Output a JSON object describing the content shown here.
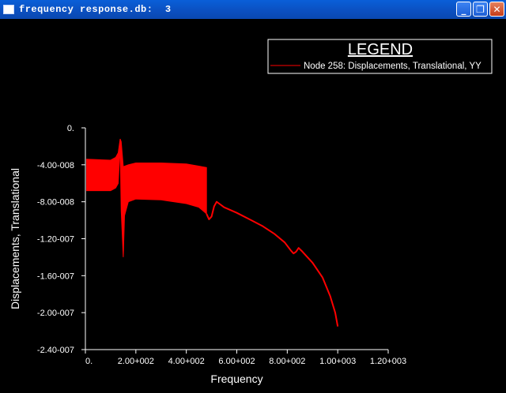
{
  "window": {
    "title": "frequency response.db:  3",
    "buttons": [
      {
        "name": "minimize-button",
        "icon": "minimize-icon",
        "glyph": "_"
      },
      {
        "name": "restore-button",
        "icon": "restore-icon",
        "glyph": "❐"
      },
      {
        "name": "close-button",
        "icon": "close-icon",
        "glyph": "✕"
      }
    ]
  },
  "chart_data": {
    "type": "line",
    "title": "",
    "xlabel": "Frequency",
    "ylabel": "Displacements, Translational",
    "xlim": [
      0,
      1200
    ],
    "ylim": [
      -2.4e-07,
      0
    ],
    "xticks": [
      0,
      200,
      400,
      600,
      800,
      1000,
      1200
    ],
    "xtick_labels": [
      "0.",
      "2.00+002",
      "4.00+002",
      "6.00+002",
      "8.00+002",
      "1.00+003",
      "1.20+003"
    ],
    "yticks": [
      0,
      -4e-08,
      -8e-08,
      -1.2e-07,
      -1.6e-07,
      -2e-07,
      -2.4e-07
    ],
    "ytick_labels": [
      "0.",
      "-4.00-008",
      "-8.00-008",
      "-1.20-007",
      "-1.60-007",
      "-2.00-007",
      "-2.40-007"
    ],
    "grid": false,
    "legend": {
      "title": "LEGEND",
      "placement": "top-right"
    },
    "colors": {
      "background": "#000000",
      "axis": "#ffffff",
      "series": "#ff0000"
    },
    "series": [
      {
        "name": "Node 258: Displacements, Translational, YY",
        "color": "#ff0000",
        "band_upper": [
          [
            5,
            -3.4e-08
          ],
          [
            100,
            -3.5e-08
          ],
          [
            120,
            -3.2e-08
          ],
          [
            130,
            -2.7e-08
          ],
          [
            138,
            -1.2e-08
          ],
          [
            142,
            -1.5e-08
          ],
          [
            150,
            -4.2e-08
          ],
          [
            170,
            -4e-08
          ],
          [
            200,
            -3.8e-08
          ],
          [
            300,
            -3.8e-08
          ],
          [
            400,
            -3.9e-08
          ],
          [
            480,
            -4.3e-08
          ]
        ],
        "band_lower": [
          [
            5,
            -6.8e-08
          ],
          [
            100,
            -6.8e-08
          ],
          [
            120,
            -6.5e-08
          ],
          [
            130,
            -6e-08
          ],
          [
            138,
            -2e-08
          ],
          [
            142,
            -9e-08
          ],
          [
            150,
            -1.4e-07
          ],
          [
            155,
            -9.5e-08
          ],
          [
            170,
            -8e-08
          ],
          [
            200,
            -7.7e-08
          ],
          [
            300,
            -7.8e-08
          ],
          [
            400,
            -8.2e-08
          ],
          [
            450,
            -8.6e-08
          ],
          [
            480,
            -9.3e-08
          ]
        ],
        "tail": [
          [
            480,
            -9.3e-08
          ],
          [
            490,
            -9.9e-08
          ],
          [
            500,
            -9.6e-08
          ],
          [
            510,
            -8.5e-08
          ],
          [
            520,
            -8e-08
          ],
          [
            530,
            -8.2e-08
          ],
          [
            550,
            -8.6e-08
          ],
          [
            600,
            -9.2e-08
          ],
          [
            650,
            -9.9e-08
          ],
          [
            700,
            -1.06e-07
          ],
          [
            750,
            -1.15e-07
          ],
          [
            790,
            -1.24e-07
          ],
          [
            815,
            -1.33e-07
          ],
          [
            825,
            -1.36e-07
          ],
          [
            835,
            -1.34e-07
          ],
          [
            845,
            -1.3e-07
          ],
          [
            860,
            -1.34e-07
          ],
          [
            900,
            -1.46e-07
          ],
          [
            940,
            -1.62e-07
          ],
          [
            970,
            -1.82e-07
          ],
          [
            990,
            -2e-07
          ],
          [
            1000,
            -2.15e-07
          ]
        ]
      }
    ]
  }
}
